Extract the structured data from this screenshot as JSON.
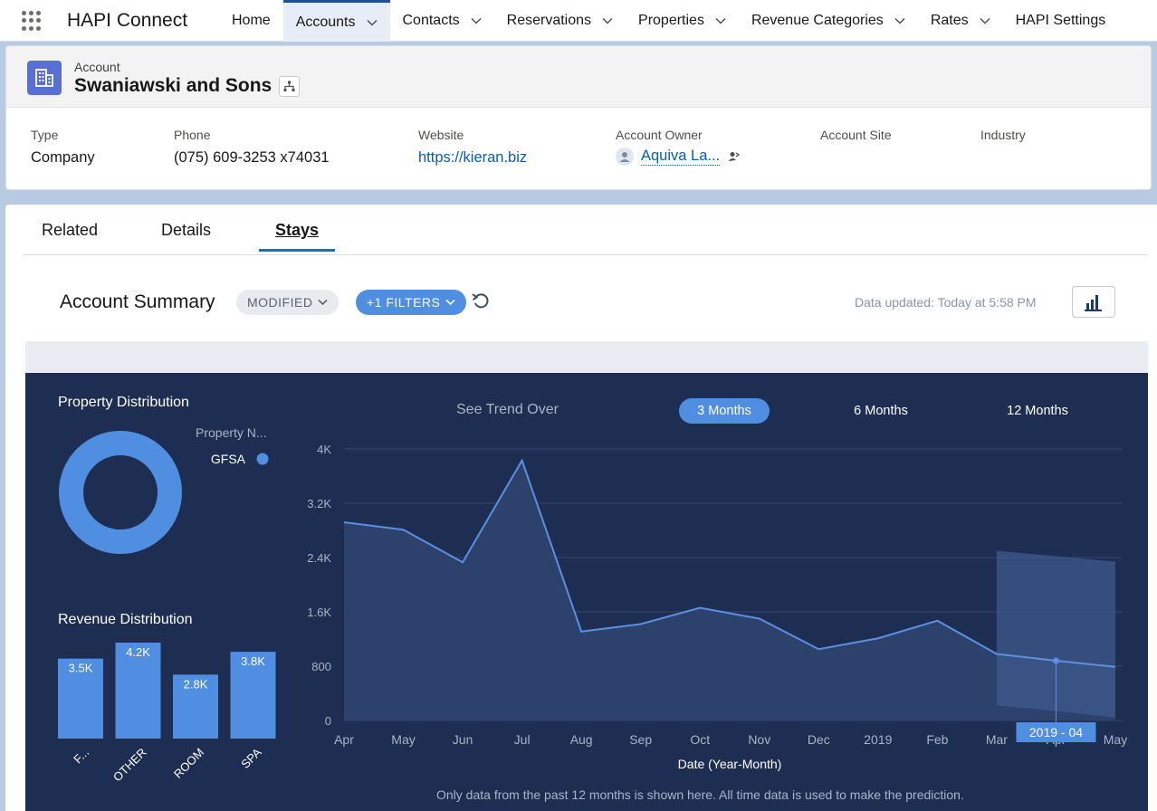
{
  "app": {
    "name": "HAPI Connect",
    "nav": [
      {
        "label": "Home",
        "chevron": false,
        "active": false
      },
      {
        "label": "Accounts",
        "chevron": true,
        "active": true
      },
      {
        "label": "Contacts",
        "chevron": true,
        "active": false
      },
      {
        "label": "Reservations",
        "chevron": true,
        "active": false
      },
      {
        "label": "Properties",
        "chevron": true,
        "active": false
      },
      {
        "label": "Revenue Categories",
        "chevron": true,
        "active": false
      },
      {
        "label": "Rates",
        "chevron": true,
        "active": false
      },
      {
        "label": "HAPI Settings",
        "chevron": false,
        "active": false
      }
    ]
  },
  "account": {
    "object_label": "Account",
    "name": "Swaniawski and Sons",
    "fields": {
      "type_label": "Type",
      "type_value": "Company",
      "phone_label": "Phone",
      "phone_value": "(075) 609-3253 x74031",
      "website_label": "Website",
      "website_value": "https://kieran.biz",
      "owner_label": "Account Owner",
      "owner_value": "Aquiva La...",
      "site_label": "Account Site",
      "site_value": "",
      "industry_label": "Industry",
      "industry_value": ""
    }
  },
  "tabs": {
    "related": "Related",
    "details": "Details",
    "stays": "Stays"
  },
  "summary": {
    "title": "Account Summary",
    "modified_label": "MODIFIED",
    "filters_label": "+1 FILTERS",
    "updated_text": "Data updated: Today at 5:58 PM"
  },
  "dashboard": {
    "property_title": "Property Distribution",
    "property_legend_title": "Property N...",
    "revenue_title": "Revenue Distribution",
    "trend_label": "See Trend Over",
    "trend_options": [
      "3 Months",
      "6 Months",
      "12 Months"
    ],
    "footnote": "Only data from the past 12 months is shown here. All time data is used to make the prediction."
  },
  "colors": {
    "accent": "#4f8ee0",
    "dash_bg": "#1e2e52",
    "line": "#5b8fe0"
  },
  "chart_data": [
    {
      "type": "pie",
      "title": "Property Distribution",
      "legend_title": "Property N...",
      "categories": [
        "GFSA"
      ],
      "values": [
        1
      ]
    },
    {
      "type": "bar",
      "title": "Revenue Distribution",
      "categories": [
        "F...",
        "OTHER",
        "ROOM",
        "SPA"
      ],
      "values": [
        3500,
        4200,
        2800,
        3800
      ],
      "value_labels": [
        "3.5K",
        "4.2K",
        "2.8K",
        "3.8K"
      ],
      "ylim": [
        0,
        4200
      ]
    },
    {
      "type": "area",
      "title": "",
      "xlabel": "Date (Year-Month)",
      "ylabel": "",
      "x": [
        "Apr",
        "May",
        "Jun",
        "Jul",
        "Aug",
        "Sep",
        "Oct",
        "Nov",
        "Dec",
        "2019",
        "Feb",
        "Mar",
        "Apr",
        "May"
      ],
      "y_ticks": [
        "0",
        "800",
        "1.6K",
        "2.4K",
        "3.2K",
        "4K"
      ],
      "ylim": [
        0,
        4000
      ],
      "series": [
        {
          "values": [
            2920,
            2810,
            2330,
            3830,
            1310,
            1420,
            1660,
            1500,
            1050,
            1210,
            1470,
            980,
            880,
            790
          ]
        }
      ],
      "prediction_band": {
        "start_index": 11,
        "upper": [
          2500,
          2420,
          2340
        ],
        "lower": [
          220,
          140,
          40
        ]
      },
      "tooltip": {
        "index": 12,
        "label": "2019 - 04"
      },
      "grid": true
    }
  ]
}
